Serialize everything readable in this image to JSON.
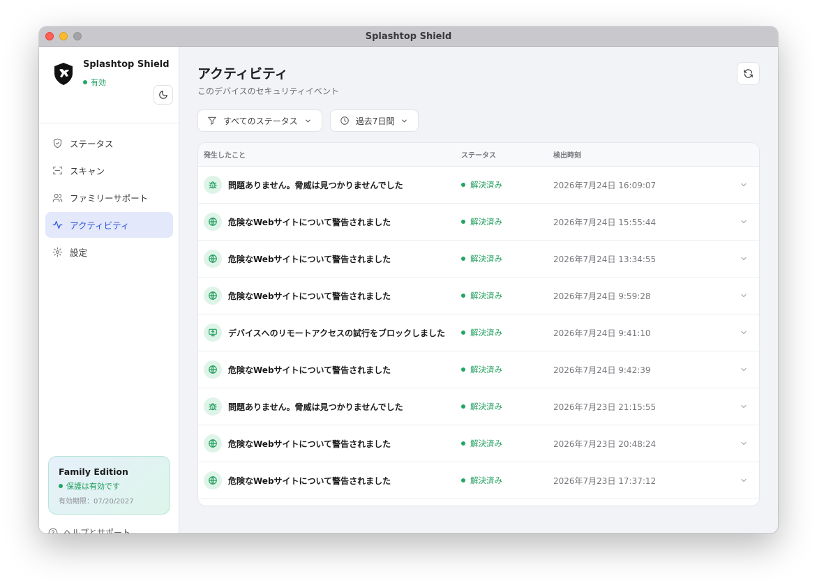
{
  "window": {
    "title": "Splashtop Shield"
  },
  "sidebar": {
    "app_name": "Splashtop Shield",
    "app_status": "有効",
    "items": [
      {
        "label": "ステータス",
        "icon": "shield-icon",
        "active": false
      },
      {
        "label": "スキャン",
        "icon": "scan-icon",
        "active": false
      },
      {
        "label": "ファミリーサポート",
        "icon": "users-icon",
        "active": false
      },
      {
        "label": "アクティビティ",
        "icon": "activity-icon",
        "active": true
      },
      {
        "label": "設定",
        "icon": "gear-icon",
        "active": false
      }
    ],
    "edition": {
      "title": "Family Edition",
      "status": "保護は有効です",
      "expiry": "有効期限：07/20/2027"
    },
    "help": "ヘルプとサポート"
  },
  "main": {
    "title": "アクティビティ",
    "subtitle": "このデバイスのセキュリティイベント",
    "filters": {
      "status": "すべてのステータス",
      "period": "過去7日間"
    },
    "table": {
      "headers": {
        "event": "発生したこと",
        "status": "ステータス",
        "time": "検出時刻"
      },
      "rows": [
        {
          "icon": "bug-icon",
          "title": "問題ありません。脅威は見つかりませんでした",
          "status": "解決済み",
          "time": "2026年7月24日 16:09:07"
        },
        {
          "icon": "globe-icon",
          "title": "危険なWebサイトについて警告されました",
          "status": "解決済み",
          "time": "2026年7月24日 15:55:44"
        },
        {
          "icon": "globe-icon",
          "title": "危険なWebサイトについて警告されました",
          "status": "解決済み",
          "time": "2026年7月24日 13:34:55"
        },
        {
          "icon": "globe-icon",
          "title": "危険なWebサイトについて警告されました",
          "status": "解決済み",
          "time": "2026年7月24日 9:59:28"
        },
        {
          "icon": "monitor-icon",
          "title": "デバイスへのリモートアクセスの試行をブロックしました",
          "status": "解決済み",
          "time": "2026年7月24日 9:41:10"
        },
        {
          "icon": "globe-icon",
          "title": "危険なWebサイトについて警告されました",
          "status": "解決済み",
          "time": "2026年7月24日 9:42:39"
        },
        {
          "icon": "bug-icon",
          "title": "問題ありません。脅威は見つかりませんでした",
          "status": "解決済み",
          "time": "2026年7月23日 21:15:55"
        },
        {
          "icon": "globe-icon",
          "title": "危険なWebサイトについて警告されました",
          "status": "解決済み",
          "time": "2026年7月23日 20:48:24"
        },
        {
          "icon": "globe-icon",
          "title": "危険なWebサイトについて警告されました",
          "status": "解決済み",
          "time": "2026年7月23日 17:37:12"
        }
      ]
    }
  },
  "colors": {
    "accent": "#2f57d8",
    "success": "#1f9d5c",
    "icon_bg": "#dff4e8"
  }
}
